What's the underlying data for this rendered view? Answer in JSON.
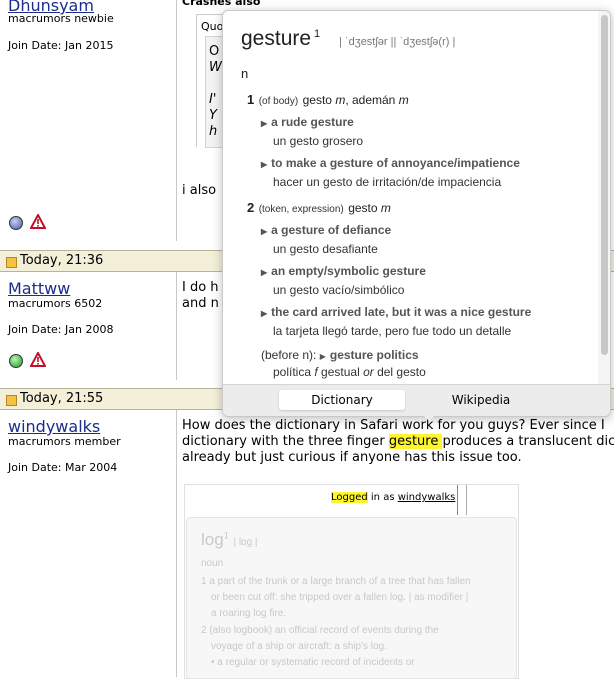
{
  "posts": [
    {
      "username": "Dhunsyam",
      "rank": "macrumors newbie",
      "join": "Join Date: Jan 2015",
      "text_top": "Crashes also",
      "quote_lines": [
        "O",
        "W",
        "I'",
        "Y",
        "h"
      ],
      "text_line": "i also"
    },
    {
      "date": "Today, 21:36",
      "username": "Mattww",
      "rank": "macrumors 6502",
      "join": "Join Date: Jan 2008",
      "text_lines": [
        "I do h",
        "and n"
      ]
    },
    {
      "date": "Today, 21:55",
      "username": "windywalks",
      "rank": "macrumors member",
      "join": "Join Date: Mar 2004",
      "line1": "How does the dictionary in Safari work for you guys? Ever since I",
      "line2_before": "dictionary with the three finger ",
      "line2_highlight": "gesture ",
      "line2_after": "produces a translucent dic",
      "line3": "already but just curious if anyone has this issue too."
    }
  ],
  "embed": {
    "logged": "Logged",
    "in_as": " in as ",
    "user": "windywalks",
    "headword": "log",
    "sup": "1",
    "pron": "| lɒɡ |",
    "pos": "noun",
    "lines": [
      "1 a part of the trunk or a large branch of a tree that has fallen",
      "or been cut off: she tripped over a fallen log. | as modifier |",
      "a roaring log fire.",
      "2 (also logbook) an official record of events during the",
      "voyage of a ship or aircraft: a ship's log.",
      "• a regular or systematic record of incidents or"
    ]
  },
  "dictionary": {
    "headword": "gesture",
    "sup": "1",
    "pron": "| ˈdʒestʃər || ˈdʒestʃə(r) |",
    "pos": "n",
    "senses": [
      {
        "num": "1",
        "label": "(of body)",
        "trans_a": "gesto ",
        "trans_a_g": "m",
        "trans_b": ", ademán ",
        "trans_b_g": "m",
        "examples": [
          {
            "phrase": "a rude gesture",
            "trans": "un gesto grosero"
          },
          {
            "phrase": "to make a gesture of annoyance/impatience",
            "trans": "hacer un gesto de irritación/de impaciencia"
          }
        ]
      },
      {
        "num": "2",
        "label": "(token, expression)",
        "trans_a": "gesto ",
        "trans_a_g": "m",
        "examples": [
          {
            "phrase": "a gesture of defiance",
            "trans": "un gesto desafiante"
          },
          {
            "phrase": "an empty/symbolic gesture",
            "trans": "un gesto vacío/simbólico"
          },
          {
            "phrase": "the card arrived late, but it was a nice gesture",
            "trans": "la tarjeta llegó tarde, pero fue todo un detalle"
          }
        ]
      }
    ],
    "before_n": "(before n): ",
    "before_phrase": "gesture politics",
    "before_trans_a": "política ",
    "before_trans_f": "f",
    "before_trans_b": " gestual ",
    "before_or": "or",
    "before_trans_c": " del gesto"
  },
  "tabs": {
    "dictionary": "Dictionary",
    "wikipedia": "Wikipedia"
  },
  "colors": {
    "highlight": "#fff52e",
    "link": "#1b2c8c",
    "header_bg": "#f3efd9"
  }
}
